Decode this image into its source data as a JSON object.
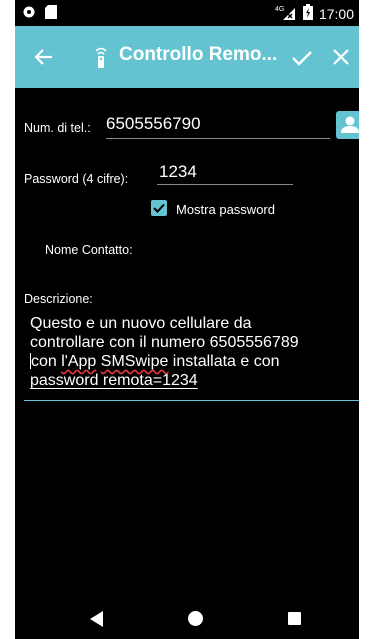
{
  "status_bar": {
    "time": "17:00",
    "network": "4G"
  },
  "app_bar": {
    "title": "Controllo Remo..."
  },
  "form": {
    "phone_label": "Num. di tel.:",
    "phone_value": "6505556790",
    "password_label": "Password (4 cifre):",
    "password_value": "1234",
    "show_password_label": "Mostra password",
    "show_password_checked": true,
    "contact_name_label": "Nome Contatto:",
    "description_label": "Descrizione:",
    "description_lines": [
      "Questo  e  un nuovo cellulare da",
      "controllare con il numero 6505556789",
      "con l'App SMSwipe installata e con",
      "password remota=1234"
    ]
  },
  "colors": {
    "accent": "#63c3d0",
    "background": "#000000",
    "text": "#ffffff",
    "spellcheck": "#e53935"
  }
}
